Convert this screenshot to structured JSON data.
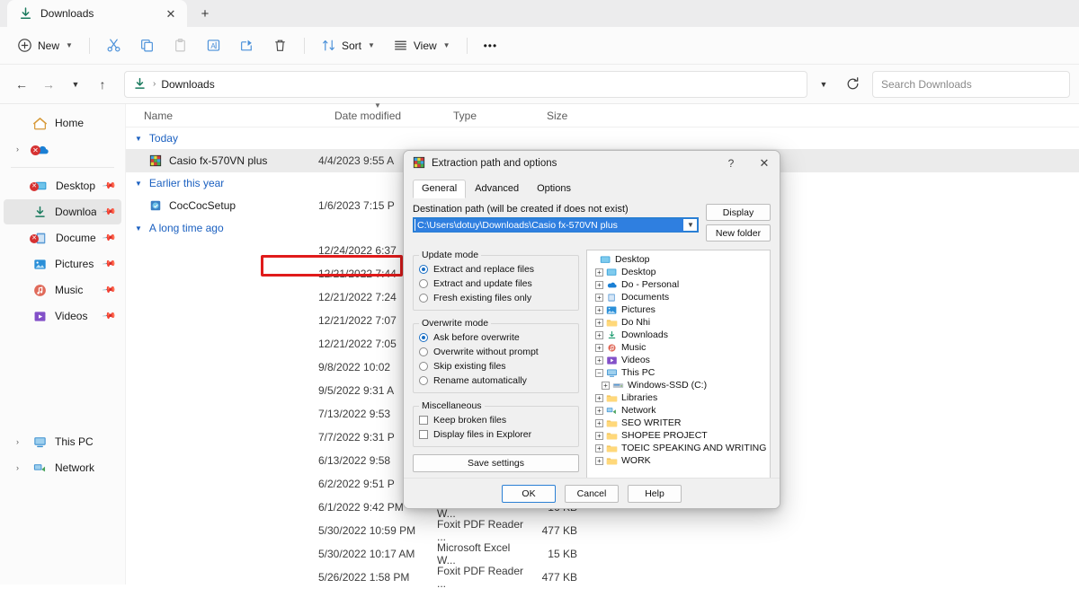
{
  "window": {
    "tab_title": "Downloads",
    "tab_close_icon": "close-icon",
    "new_tab_icon": "plus-icon"
  },
  "toolbar": {
    "new_label": "New",
    "sort_label": "Sort",
    "view_label": "View",
    "more_label": "•••",
    "icons": {
      "new": "plus-circle-icon",
      "cut": "scissors-icon",
      "copy": "copy-icon",
      "paste": "paste-icon",
      "rename": "rename-icon",
      "share": "share-icon",
      "delete": "trash-icon",
      "sort": "sort-arrows-icon",
      "view": "list-lines-icon"
    }
  },
  "address": {
    "back_icon": "arrow-left-icon",
    "forward_icon": "arrow-right-icon",
    "recent_icon": "chevron-down-icon",
    "up_icon": "arrow-up-icon",
    "crumb_icon": "downloads-icon",
    "crumb_label": "Downloads",
    "separator": "›",
    "history_icon": "chevron-down-icon",
    "refresh_icon": "refresh-icon",
    "search_placeholder": "Search Downloads"
  },
  "sidebar": {
    "items": [
      {
        "label": "Home",
        "icon": "home-icon",
        "expander": "",
        "pinned": false,
        "selected": false
      },
      {
        "label": "",
        "icon": "onedrive-error-icon",
        "expander": "›",
        "pinned": false,
        "selected": false
      },
      {
        "label": "Desktop",
        "icon": "desktop-error-icon",
        "expander": "",
        "pinned": true,
        "selected": false
      },
      {
        "label": "Downloads",
        "icon": "downloads-icon",
        "expander": "",
        "pinned": true,
        "selected": true
      },
      {
        "label": "Documents",
        "icon": "documents-error-icon",
        "expander": "",
        "pinned": true,
        "selected": false
      },
      {
        "label": "Pictures",
        "icon": "pictures-icon",
        "expander": "",
        "pinned": true,
        "selected": false
      },
      {
        "label": "Music",
        "icon": "music-icon",
        "expander": "",
        "pinned": true,
        "selected": false
      },
      {
        "label": "Videos",
        "icon": "videos-icon",
        "expander": "",
        "pinned": true,
        "selected": false
      },
      {
        "label": "This PC",
        "icon": "pc-icon",
        "expander": "›",
        "pinned": false,
        "selected": false
      },
      {
        "label": "Network",
        "icon": "network-icon",
        "expander": "›",
        "pinned": false,
        "selected": false
      }
    ]
  },
  "filelist": {
    "columns": [
      "Name",
      "Date modified",
      "Type",
      "Size"
    ],
    "sort_column_index": 1,
    "groups": [
      {
        "label": "Today",
        "rows": [
          {
            "name": "Casio fx-570VN plus",
            "date": "4/4/2023 9:55 A",
            "type": "",
            "size": "",
            "icon": "winrar-archive-icon",
            "selected": true,
            "highlighted": true
          }
        ]
      },
      {
        "label": "Earlier this year",
        "rows": [
          {
            "name": "CocCocSetup",
            "date": "1/6/2023 7:15 P",
            "type": "",
            "size": "",
            "icon": "coccoc-setup-icon",
            "selected": false,
            "highlighted": false
          }
        ]
      },
      {
        "label": "A long time ago",
        "rows": [
          {
            "name": "",
            "date": "12/24/2022 6:37",
            "type": "",
            "size": "",
            "icon": "",
            "selected": false,
            "highlighted": false
          },
          {
            "name": "",
            "date": "12/21/2022 7:44",
            "type": "",
            "size": "",
            "icon": "",
            "selected": false,
            "highlighted": false
          },
          {
            "name": "",
            "date": "12/21/2022 7:24",
            "type": "",
            "size": "",
            "icon": "",
            "selected": false,
            "highlighted": false
          },
          {
            "name": "",
            "date": "12/21/2022 7:07",
            "type": "",
            "size": "",
            "icon": "",
            "selected": false,
            "highlighted": false
          },
          {
            "name": "",
            "date": "12/21/2022 7:05",
            "type": "",
            "size": "",
            "icon": "",
            "selected": false,
            "highlighted": false
          },
          {
            "name": "",
            "date": "9/8/2022 10:02",
            "type": "",
            "size": "",
            "icon": "",
            "selected": false,
            "highlighted": false
          },
          {
            "name": "",
            "date": "9/5/2022 9:31 A",
            "type": "",
            "size": "",
            "icon": "",
            "selected": false,
            "highlighted": false
          },
          {
            "name": "",
            "date": "7/13/2022 9:53",
            "type": "",
            "size": "",
            "icon": "",
            "selected": false,
            "highlighted": false
          },
          {
            "name": "",
            "date": "7/7/2022 9:31 P",
            "type": "",
            "size": "",
            "icon": "",
            "selected": false,
            "highlighted": false
          },
          {
            "name": "",
            "date": "6/13/2022 9:58",
            "type": "",
            "size": "",
            "icon": "",
            "selected": false,
            "highlighted": false
          },
          {
            "name": "",
            "date": "6/2/2022 9:51 P",
            "type": "",
            "size": "",
            "icon": "",
            "selected": false,
            "highlighted": false
          },
          {
            "name": "",
            "date": "6/1/2022 9:42 PM",
            "type": "Microsoft Excel W...",
            "size": "16 KB",
            "icon": "",
            "selected": false,
            "highlighted": false
          },
          {
            "name": "",
            "date": "5/30/2022 10:59 PM",
            "type": "Foxit PDF Reader ...",
            "size": "477 KB",
            "icon": "",
            "selected": false,
            "highlighted": false
          },
          {
            "name": "",
            "date": "5/30/2022 10:17 AM",
            "type": "Microsoft Excel W...",
            "size": "15 KB",
            "icon": "",
            "selected": false,
            "highlighted": false
          },
          {
            "name": "",
            "date": "5/26/2022 1:58 PM",
            "type": "Foxit PDF Reader ...",
            "size": "477 KB",
            "icon": "",
            "selected": false,
            "highlighted": false
          }
        ]
      }
    ]
  },
  "dialog": {
    "title": "Extraction path and options",
    "title_icon": "winrar-icon",
    "help_button": "?",
    "close_button": "✕",
    "tabs": [
      {
        "label": "General",
        "active": true
      },
      {
        "label": "Advanced",
        "active": false
      },
      {
        "label": "Options",
        "active": false
      }
    ],
    "destination": {
      "label": "Destination path (will be created if does not exist)",
      "value": "C:\\Users\\dotuy\\Downloads\\Casio fx-570VN plus",
      "dropdown_icon": "chevron-down-icon"
    },
    "side_buttons": [
      {
        "label": "Display"
      },
      {
        "label": "New folder"
      }
    ],
    "update_mode": {
      "legend": "Update mode",
      "options": [
        {
          "label": "Extract and replace files",
          "checked": true
        },
        {
          "label": "Extract and update files",
          "checked": false
        },
        {
          "label": "Fresh existing files only",
          "checked": false
        }
      ]
    },
    "overwrite_mode": {
      "legend": "Overwrite mode",
      "options": [
        {
          "label": "Ask before overwrite",
          "checked": true
        },
        {
          "label": "Overwrite without prompt",
          "checked": false
        },
        {
          "label": "Skip existing files",
          "checked": false
        },
        {
          "label": "Rename automatically",
          "checked": false
        }
      ]
    },
    "miscellaneous": {
      "legend": "Miscellaneous",
      "options": [
        {
          "label": "Keep broken files",
          "checked": false
        },
        {
          "label": "Display files in Explorer",
          "checked": false
        }
      ]
    },
    "save_settings_label": "Save settings",
    "tree": [
      {
        "label": "Desktop",
        "depth": 0,
        "expander": "",
        "icon": "desktop-icon"
      },
      {
        "label": "Desktop",
        "depth": 1,
        "expander": "+",
        "icon": "desktop-icon"
      },
      {
        "label": "Do - Personal",
        "depth": 1,
        "expander": "+",
        "icon": "onedrive-icon"
      },
      {
        "label": "Documents",
        "depth": 1,
        "expander": "+",
        "icon": "documents-icon"
      },
      {
        "label": "Pictures",
        "depth": 1,
        "expander": "+",
        "icon": "pictures-icon"
      },
      {
        "label": "Do Nhi",
        "depth": 1,
        "expander": "+",
        "icon": "folder-icon"
      },
      {
        "label": "Downloads",
        "depth": 1,
        "expander": "+",
        "icon": "downloads-icon"
      },
      {
        "label": "Music",
        "depth": 1,
        "expander": "+",
        "icon": "music-icon"
      },
      {
        "label": "Videos",
        "depth": 1,
        "expander": "+",
        "icon": "videos-icon"
      },
      {
        "label": "This PC",
        "depth": 1,
        "expander": "−",
        "icon": "pc-icon"
      },
      {
        "label": "Windows-SSD (C:)",
        "depth": 2,
        "expander": "+",
        "icon": "drive-icon"
      },
      {
        "label": "Libraries",
        "depth": 1,
        "expander": "+",
        "icon": "folder-icon"
      },
      {
        "label": "Network",
        "depth": 1,
        "expander": "+",
        "icon": "network-icon"
      },
      {
        "label": "SEO WRITER",
        "depth": 1,
        "expander": "+",
        "icon": "folder-icon"
      },
      {
        "label": "SHOPEE PROJECT",
        "depth": 1,
        "expander": "+",
        "icon": "folder-icon"
      },
      {
        "label": "TOEIC SPEAKING AND WRITING",
        "depth": 1,
        "expander": "+",
        "icon": "folder-icon"
      },
      {
        "label": "WORK",
        "depth": 1,
        "expander": "+",
        "icon": "folder-icon"
      }
    ],
    "footer_buttons": [
      {
        "label": "OK",
        "default": true
      },
      {
        "label": "Cancel",
        "default": false
      },
      {
        "label": "Help",
        "default": false
      }
    ]
  },
  "colors": {
    "accent": "#2a7fd4",
    "highlight_box": "#e01b1b",
    "group_header": "#1b60c0",
    "selection": "#2f7fe0"
  }
}
